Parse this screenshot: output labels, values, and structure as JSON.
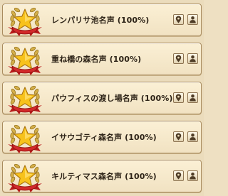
{
  "achievements": [
    {
      "label": "レンパリサ池名声 (100%)",
      "badge_icon": "laurel-star-icon",
      "location_icon": "map-pin-icon",
      "profile_icon": "person-icon"
    },
    {
      "label": "重ね橋の森名声 (100%)",
      "badge_icon": "laurel-star-icon",
      "location_icon": "map-pin-icon",
      "profile_icon": "person-icon"
    },
    {
      "label": "パウフィスの渡し場名声 (100%)",
      "badge_icon": "laurel-star-icon",
      "location_icon": "map-pin-icon",
      "profile_icon": "person-icon"
    },
    {
      "label": "イサウゴティ森名声 (100%)",
      "badge_icon": "laurel-star-icon",
      "location_icon": "map-pin-icon",
      "profile_icon": "person-icon"
    },
    {
      "label": "キルティマス森名声 (100%)",
      "badge_icon": "laurel-star-icon",
      "location_icon": "map-pin-icon",
      "profile_icon": "person-icon"
    }
  ],
  "colors": {
    "star": "#f7c21c",
    "laurel": "#c9a440",
    "ribbon": "#c41f1f",
    "text": "#2e2418",
    "row_border": "#a88b5e"
  }
}
